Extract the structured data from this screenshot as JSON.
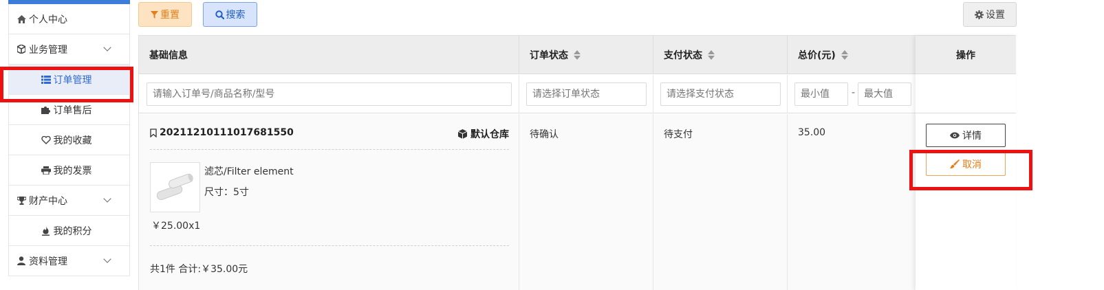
{
  "sidebar": {
    "items": [
      {
        "label": "个人中心",
        "icon": "home-icon"
      },
      {
        "label": "业务管理",
        "icon": "cube-icon"
      },
      {
        "label": "订单管理",
        "icon": "list-icon"
      },
      {
        "label": "订单售后",
        "icon": "puzzle-icon"
      },
      {
        "label": "我的收藏",
        "icon": "heart-icon"
      },
      {
        "label": "我的发票",
        "icon": "printer-icon"
      },
      {
        "label": "财产中心",
        "icon": "trophy-icon"
      },
      {
        "label": "我的积分",
        "icon": "flame-icon"
      },
      {
        "label": "资料管理",
        "icon": "user-icon"
      }
    ]
  },
  "toolbar": {
    "reset_label": "重置",
    "search_label": "搜索",
    "settings_label": "设置"
  },
  "table": {
    "headers": {
      "basic": "基础信息",
      "order_status": "订单状态",
      "pay_status": "支付状态",
      "total": "总价(元)",
      "actions": "操作"
    },
    "filters": {
      "basic_placeholder": "请输入订单号/商品名称/型号",
      "order_status_placeholder": "请选择订单状态",
      "pay_status_placeholder": "请选择支付状态",
      "min_placeholder": "最小值",
      "max_placeholder": "最大值",
      "range_sep": "-"
    },
    "rows": [
      {
        "order_no": "20211210111017681550",
        "warehouse": "默认仓库",
        "product_name": "滤芯/Filter element",
        "product_spec": "尺寸：5寸",
        "price_qty": "￥25.00x1",
        "summary": "共1件 合计:￥35.00元",
        "order_status": "待确认",
        "pay_status": "待支付",
        "total": "35.00",
        "detail_label": "详情",
        "cancel_label": "取消"
      }
    ]
  },
  "colors": {
    "accent": "#3b7dd8",
    "highlight": "#ee1111",
    "cancel": "#e87b12"
  }
}
